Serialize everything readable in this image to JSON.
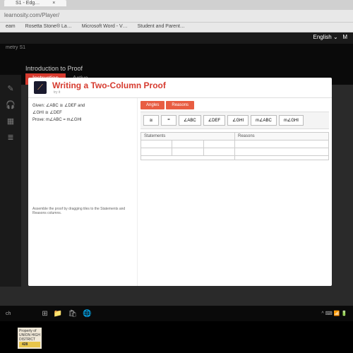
{
  "browser": {
    "tabs": [
      {
        "label": "S1 - Edg…",
        "close": "×"
      }
    ],
    "url": "learnosity.com/Player/",
    "bookmarks": [
      "eam",
      "Rosetta Stone® La…",
      "Microsoft Word - V…",
      "Student and Parent…"
    ]
  },
  "lms": {
    "lang": "English",
    "course": "metry S1",
    "lesson_header": "Introduction to Proof",
    "tabs": [
      {
        "label": "Instruction",
        "active": true
      },
      {
        "label": "Active",
        "active": false
      }
    ]
  },
  "icons": {
    "pencil": "✎",
    "headphones": "🎧",
    "calendar": "▦",
    "resources": "≣"
  },
  "lesson": {
    "app_icon": "⟋",
    "title": "Writing a Two-Column Proof",
    "sub": "try it"
  },
  "problem": {
    "given_l1": "Given: ∠ABC ≅ ∠DEF and",
    "given_l2": "∠GHI ≅ ∠DEF",
    "prove": "Prove: m∠ABC = m∠GHI",
    "hint": "Assemble the proof by dragging tiles to the Statements and Reasons columns."
  },
  "selectors": [
    {
      "label": "Angles",
      "sel": true
    },
    {
      "label": "Reasons",
      "sel": false
    }
  ],
  "tiles": [
    "≅",
    "=",
    "∠ABC",
    "∠DEF",
    "∠GHI",
    "m∠ABC",
    "m∠GHI"
  ],
  "columns": {
    "statements": "Statements",
    "reasons": "Reasons"
  },
  "taskbar": {
    "search": "ch",
    "tray": "^ ⌨ 📶 🔋"
  },
  "sticker": {
    "l1": "Property of",
    "l2": "UNION HIGH",
    "l3": "DISTRICT",
    "id": "428"
  }
}
